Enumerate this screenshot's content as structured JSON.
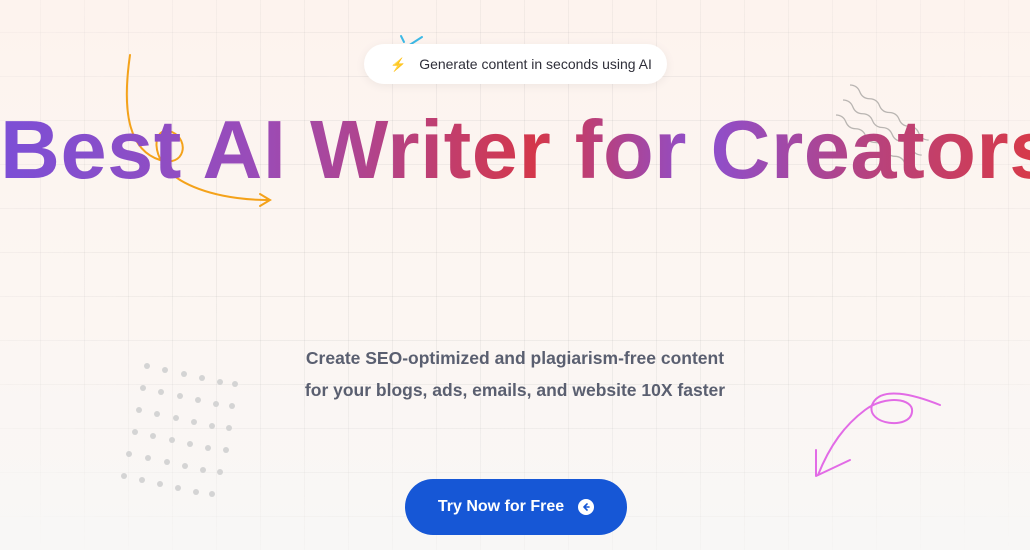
{
  "badge": {
    "icon": "lightning-bolt-icon",
    "text": "Generate content in seconds using AI"
  },
  "hero": {
    "headline": "Best AI Writer for Creators",
    "subtitle_line1": "Create SEO-optimized and plagiarism-free content",
    "subtitle_line2": "for your blogs, ads, emails, and website 10X faster"
  },
  "cta": {
    "label": "Try Now for Free",
    "icon": "arrow-left-circle-icon"
  },
  "colors": {
    "cta_background": "#1657d6",
    "headline_purple": "#7c4fd6",
    "headline_red": "#d4374a",
    "subtitle_text": "#5a5f70",
    "accent_orange": "#f4a21a",
    "accent_pink": "#e26be6"
  }
}
